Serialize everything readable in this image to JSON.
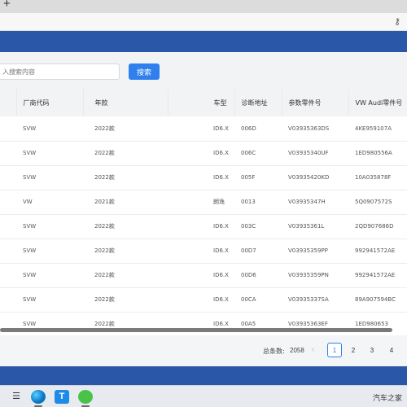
{
  "browser": {
    "new_tab_label": "+",
    "key_icon": "key-icon"
  },
  "search": {
    "placeholder": "入搜索内容",
    "button_label": "搜索"
  },
  "table": {
    "headers": [
      "厂商代码",
      "年款",
      "车型",
      "诊断地址",
      "参数零件号",
      "VW Audi零件号"
    ],
    "rows": [
      [
        "SVW",
        "2022款",
        "ID6.X",
        "006D",
        "V03935363DS",
        "4KE959107A"
      ],
      [
        "SVW",
        "2022款",
        "ID6.X",
        "006C",
        "V03935340UF",
        "1ED980556A"
      ],
      [
        "SVW",
        "2022款",
        "ID6.X",
        "005F",
        "V03935420KD",
        "10A035878F"
      ],
      [
        "VW",
        "2021款",
        "朗逸",
        "0013",
        "V03935347H",
        "5Q0907572S"
      ],
      [
        "SVW",
        "2022款",
        "ID6.X",
        "003C",
        "V03935361L",
        "2QD907686D"
      ],
      [
        "SVW",
        "2022款",
        "ID6.X",
        "00D7",
        "V03935359PP",
        "992941572AE"
      ],
      [
        "SVW",
        "2022款",
        "ID6.X",
        "00D6",
        "V03935359PN",
        "992941572AE"
      ],
      [
        "SVW",
        "2022款",
        "ID6.X",
        "00CA",
        "V03935337SA",
        "89A907594BC"
      ],
      [
        "SVW",
        "2022款",
        "ID6.X",
        "00A5",
        "V03935363EF",
        "1ED980653"
      ]
    ]
  },
  "pagination": {
    "total_label": "总条数:",
    "total_count": "2058",
    "prev": "‹",
    "pages": [
      "1",
      "2",
      "3",
      "4"
    ],
    "current_page": "1"
  },
  "taskbar": {
    "task_view_glyph": "☰",
    "app_t_glyph": "T",
    "watermark": "汽车之家"
  },
  "colors": {
    "header_blue": "#2a57a8",
    "accent": "#2f7fef"
  }
}
